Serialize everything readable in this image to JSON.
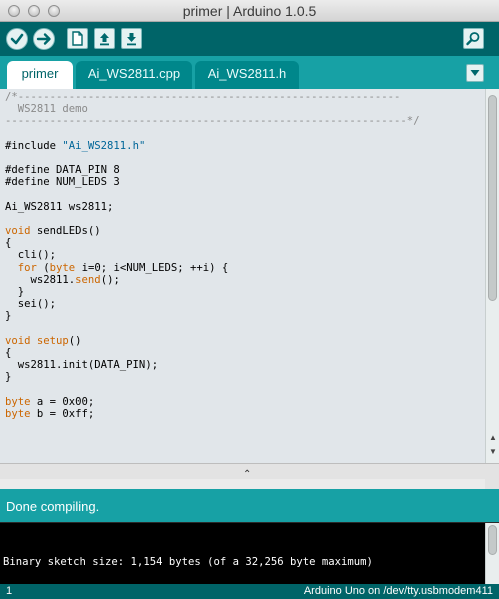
{
  "window": {
    "title": "primer | Arduino 1.0.5"
  },
  "toolbar": {
    "verify_icon": "check-icon",
    "upload_icon": "arrow-right-icon",
    "new_icon": "new-file-icon",
    "open_icon": "arrow-up-icon",
    "save_icon": "arrow-down-icon",
    "serial_icon": "magnifier-icon"
  },
  "tabs": [
    {
      "label": "primer",
      "active": true
    },
    {
      "label": "Ai_WS2811.cpp",
      "active": false
    },
    {
      "label": "Ai_WS2811.h",
      "active": false
    }
  ],
  "editor": {
    "lines": [
      "/*------------------------------------------------------------",
      "  WS2811 demo",
      "---------------------------------------------------------------*/",
      "",
      "#include \"Ai_WS2811.h\"",
      "",
      "#define DATA_PIN 8",
      "#define NUM_LEDS 3",
      "",
      "Ai_WS2811 ws2811;",
      "",
      "void sendLEDs()",
      "{",
      "  cli();",
      "  for (byte i=0; i<NUM_LEDS; ++i) {",
      "    ws2811.send();",
      "  }",
      "  sei();",
      "}",
      "",
      "void setup()",
      "{",
      "  ws2811.init(DATA_PIN);",
      "}",
      "",
      "byte a = 0x00;",
      "byte b = 0xff;"
    ]
  },
  "status": {
    "message": "Done compiling."
  },
  "console": {
    "output": "Binary sketch size: 1,154 bytes (of a 32,256 byte maximum)"
  },
  "footer": {
    "line_number": "1",
    "board": "Arduino Uno on /dev/tty.usbmodem411"
  },
  "colors": {
    "toolbar": "#006468",
    "tabbar": "#17a1a5",
    "editor_bg": "#e1e6ea",
    "keyword": "#cc6600",
    "string": "#006699",
    "comment": "#8a8a8a"
  }
}
